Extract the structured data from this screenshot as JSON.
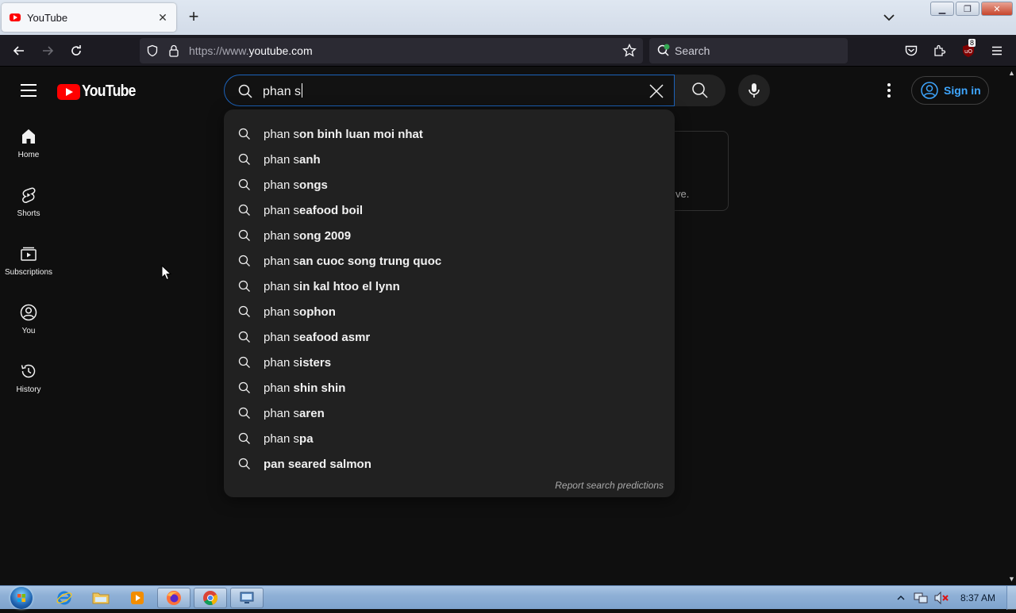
{
  "browser": {
    "tab_title": "YouTube",
    "url_dim": "https://www.",
    "url_host": "youtube.com",
    "search_placeholder": "Search",
    "extension_badge": "8"
  },
  "youtube": {
    "logo_text": "YouTube",
    "search_query": "phan s",
    "signin_label": "Sign in",
    "sidebar": [
      {
        "label": "Home",
        "icon": "home-icon"
      },
      {
        "label": "Shorts",
        "icon": "shorts-icon"
      },
      {
        "label": "Subscriptions",
        "icon": "subscriptions-icon"
      },
      {
        "label": "You",
        "icon": "you-icon"
      },
      {
        "label": "History",
        "icon": "history-icon"
      }
    ],
    "background_fragment": "ve.",
    "suggestions": [
      {
        "prefix": "phan s",
        "rest": "on binh luan moi nhat"
      },
      {
        "prefix": "phan s",
        "rest": "anh"
      },
      {
        "prefix": "phan s",
        "rest": "ongs"
      },
      {
        "prefix": "phan s",
        "rest": "eafood boil"
      },
      {
        "prefix": "phan s",
        "rest": "ong 2009"
      },
      {
        "prefix": "phan s",
        "rest": "an cuoc song trung quoc"
      },
      {
        "prefix": "phan s",
        "rest": "in kal htoo el lynn"
      },
      {
        "prefix": "phan s",
        "rest": "ophon"
      },
      {
        "prefix": "phan s",
        "rest": "eafood asmr"
      },
      {
        "prefix": "phan s",
        "rest": "isters"
      },
      {
        "prefix": "phan ",
        "rest": "shin shin"
      },
      {
        "prefix": "phan s",
        "rest": "aren"
      },
      {
        "prefix": "phan s",
        "rest": "pa"
      },
      {
        "prefix": "",
        "rest": "pan seared salmon"
      }
    ],
    "report_label": "Report search predictions"
  },
  "taskbar": {
    "clock": "8:37 AM",
    "apps": [
      "internet-explorer-icon",
      "file-explorer-icon",
      "media-player-icon",
      "firefox-icon",
      "chrome-icon",
      "remote-desktop-icon"
    ]
  },
  "colors": {
    "yt_bg": "#0f0f0f",
    "dropdown_bg": "#212121",
    "accent_red": "#ff0000",
    "signin_blue": "#3ea6ff",
    "search_focus": "#1c62b9"
  }
}
